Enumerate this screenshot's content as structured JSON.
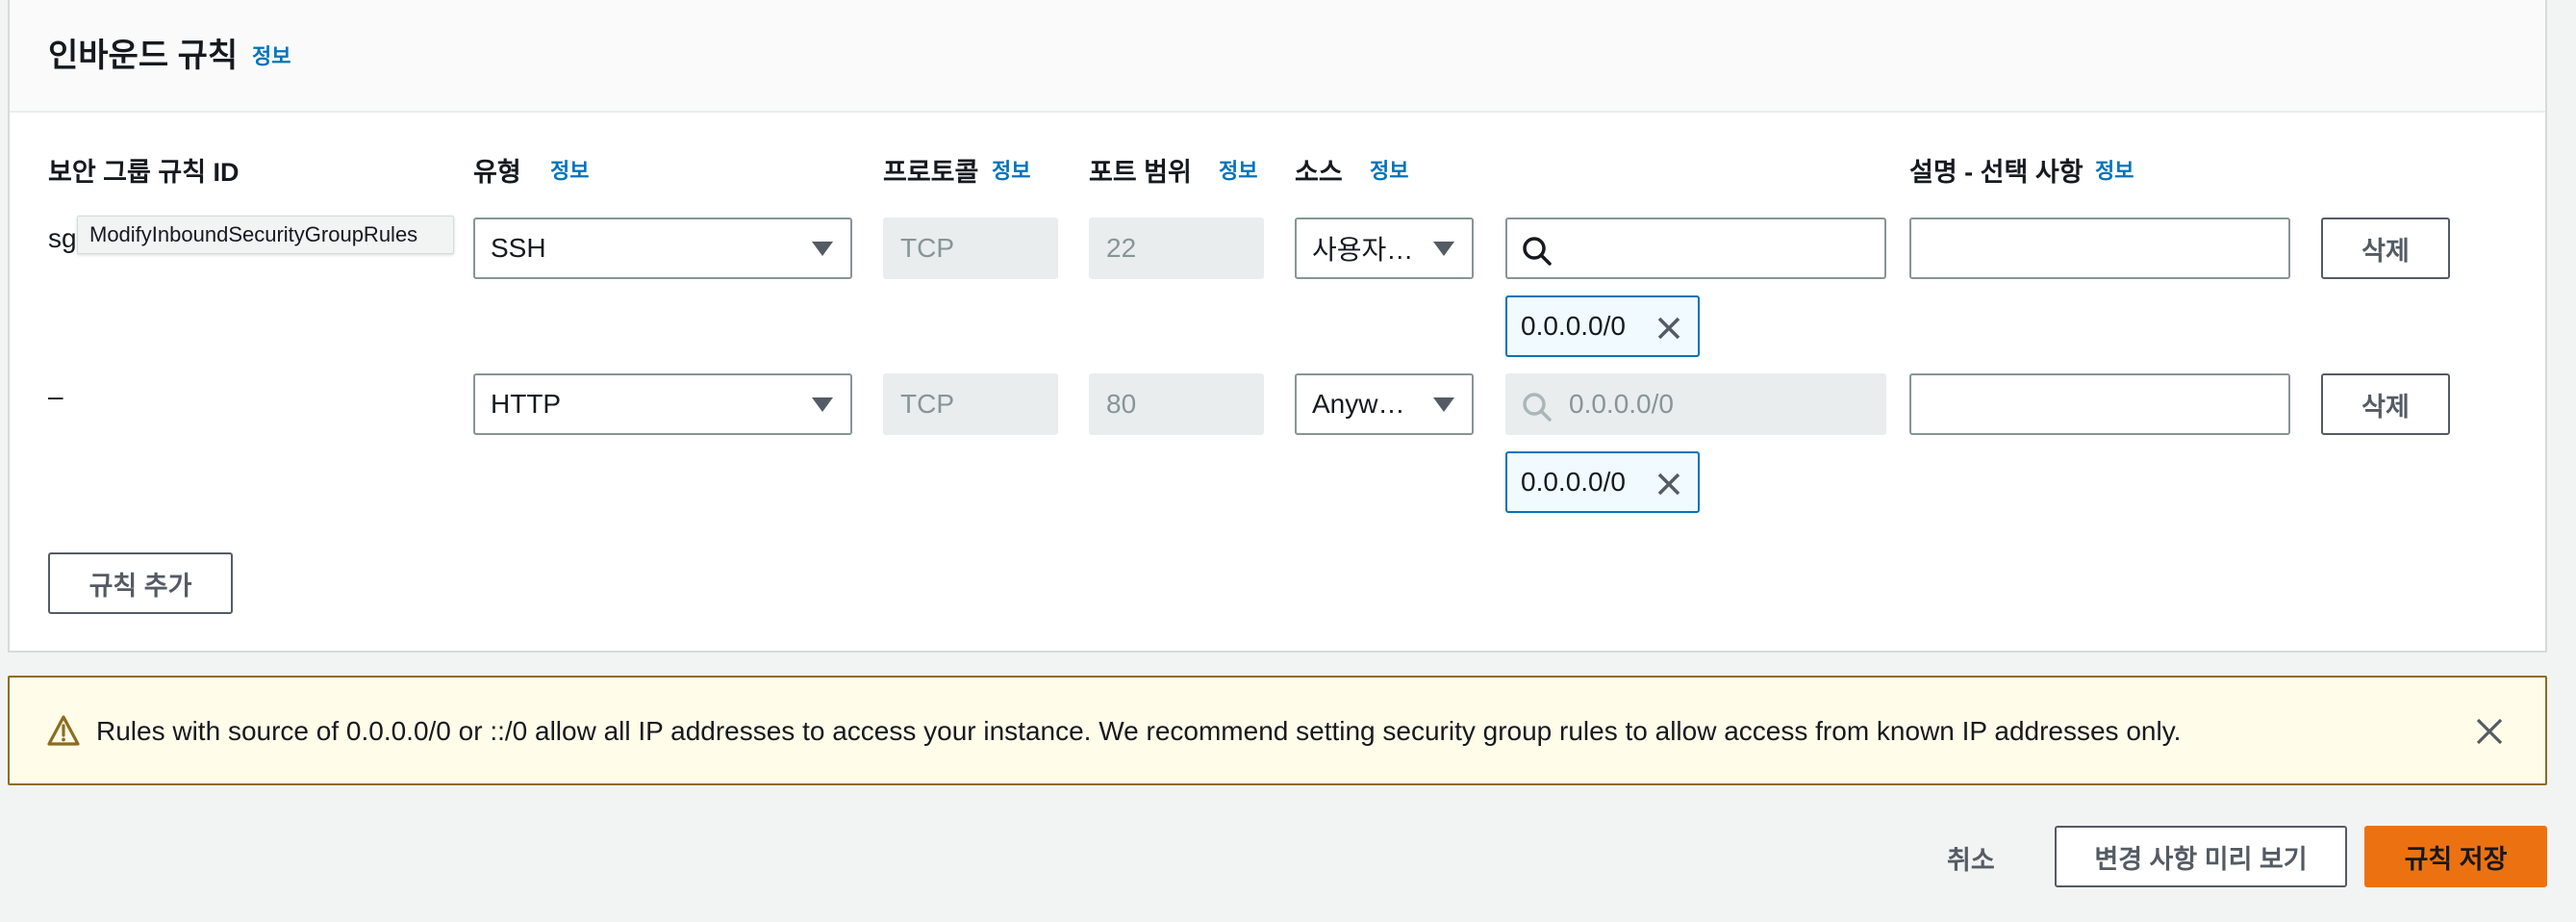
{
  "section": {
    "title": "인바운드 규칙",
    "info": "정보"
  },
  "columns": {
    "rule_id": "보안 그룹 규칙 ID",
    "type": "유형",
    "type_info": "정보",
    "protocol": "프로토콜",
    "protocol_info": "정보",
    "port": "포트 범위",
    "port_info": "정보",
    "source": "소스",
    "source_info": "정보",
    "description": "설명 - 선택 사항",
    "description_info": "정보"
  },
  "rows": [
    {
      "rule_id": "sg",
      "type": "SSH",
      "protocol": "TCP",
      "port": "22",
      "source_select": "사용자…",
      "search_value": "",
      "token": "0.0.0.0/0",
      "description": "",
      "delete_label": "삭제"
    },
    {
      "rule_id": "–",
      "type": "HTTP",
      "protocol": "TCP",
      "port": "80",
      "source_select": "Anyw…",
      "search_placeholder": "0.0.0.0/0",
      "token": "0.0.0.0/0",
      "description": "",
      "delete_label": "삭제"
    }
  ],
  "tooltip": "ModifyInboundSecurityGroupRules",
  "add_rule_label": "규칙 추가",
  "alert": {
    "text": "Rules with source of 0.0.0.0/0 or ::/0 allow all IP addresses to access your instance. We recommend setting security group rules to allow access from known IP addresses only."
  },
  "footer": {
    "cancel": "취소",
    "preview": "변경 사항 미리 보기",
    "save": "규칙 저장"
  },
  "colors": {
    "accent": "#0073bb",
    "primary": "#ec7211",
    "warning_bg": "#fffce9",
    "warning_border": "#8c6d1f"
  }
}
